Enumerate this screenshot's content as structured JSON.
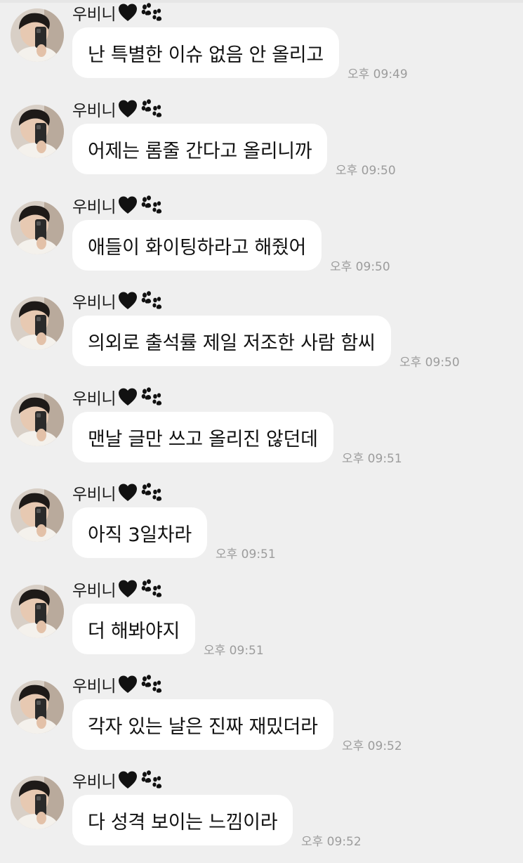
{
  "chat": {
    "sender_name": "우비니",
    "sender_name_icons": [
      "black-heart-icon",
      "paw-icon"
    ],
    "colors": {
      "background": "#efefef",
      "bubble": "#ffffff",
      "text": "#111111",
      "time": "#9c9c9c"
    },
    "messages": [
      {
        "text": "난 특별한 이슈 없음 안 올리고",
        "time": "오후 09:49"
      },
      {
        "text": "어제는 롬줄 간다고 올리니까",
        "time": "오후 09:50"
      },
      {
        "text": "애들이 화이팅하라고 해줬어",
        "time": "오후 09:50"
      },
      {
        "text": "의외로 출석률 제일 저조한 사람 함씨",
        "time": "오후 09:50"
      },
      {
        "text": "맨날 글만 쓰고 올리진 않던데",
        "time": "오후 09:51"
      },
      {
        "text": "아직 3일차라",
        "time": "오후 09:51"
      },
      {
        "text": "더 해봐야지",
        "time": "오후 09:51"
      },
      {
        "text": "각자 있는 날은 진짜 재밌더라",
        "time": "오후 09:52"
      },
      {
        "text": "다 성격 보이는 느낌이라",
        "time": "오후 09:52"
      }
    ]
  }
}
